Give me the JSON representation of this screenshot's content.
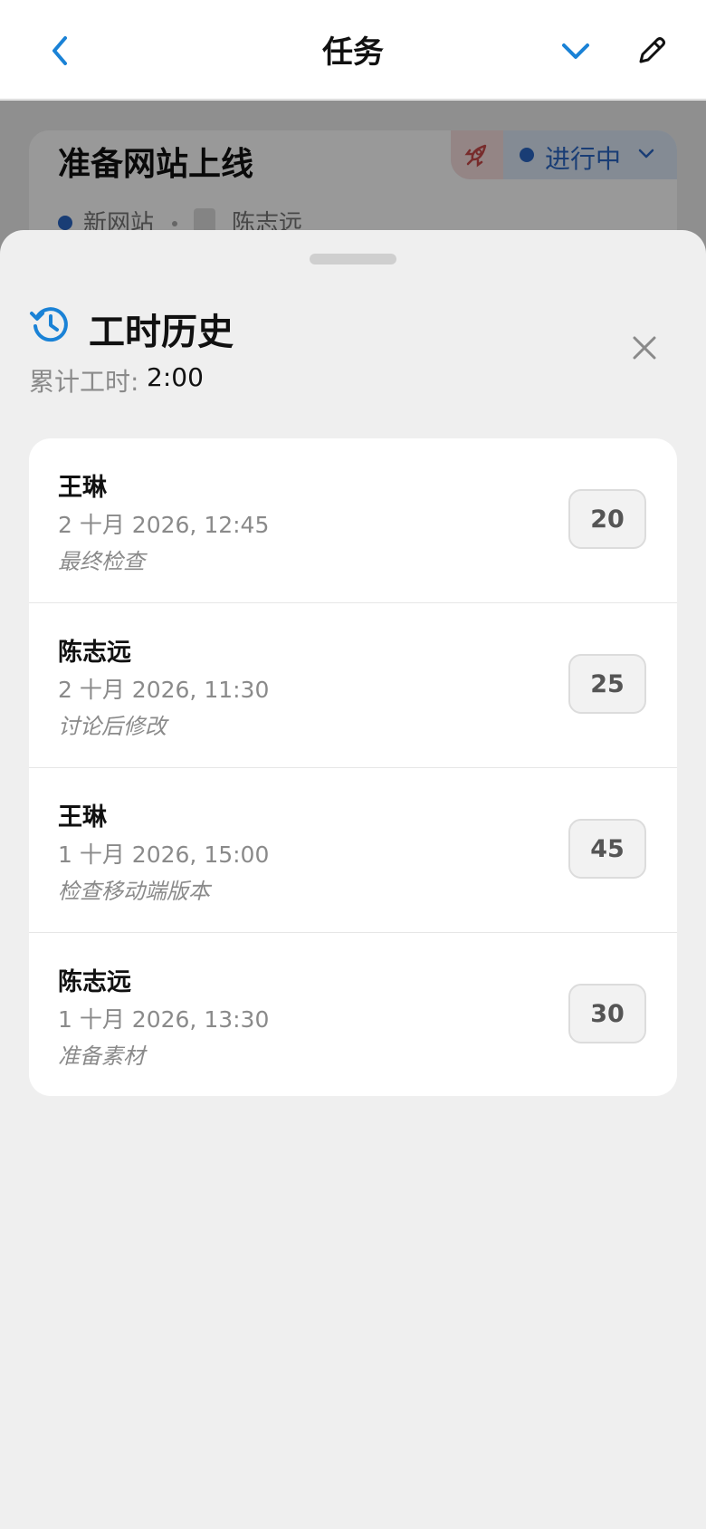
{
  "navbar": {
    "title": "任务",
    "back_icon": "chevron-left-icon",
    "dropdown_icon": "chevron-down-icon",
    "edit_icon": "pencil-icon",
    "accent_color": "#1a82d6"
  },
  "task": {
    "title": "准备网站上线",
    "status": "进行中",
    "project": "新网站",
    "assignee": "陈志远",
    "status_color": "#2b66c4",
    "rocket_icon": "rocket-icon"
  },
  "sheet": {
    "title": "工时历史",
    "icon": "history-clock-icon",
    "total_label": "累计工时:",
    "total_value": "2:00",
    "close_icon": "close-icon"
  },
  "entries": [
    {
      "name": "王琳",
      "datetime": "2 十月 2026, 12:45",
      "note": "最终检查",
      "minutes": "20"
    },
    {
      "name": "陈志远",
      "datetime": "2 十月 2026, 11:30",
      "note": "讨论后修改",
      "minutes": "25"
    },
    {
      "name": "王琳",
      "datetime": "1 十月 2026, 15:00",
      "note": "检查移动端版本",
      "minutes": "45"
    },
    {
      "name": "陈志远",
      "datetime": "1 十月 2026, 13:30",
      "note": "准备素材",
      "minutes": "30"
    }
  ]
}
